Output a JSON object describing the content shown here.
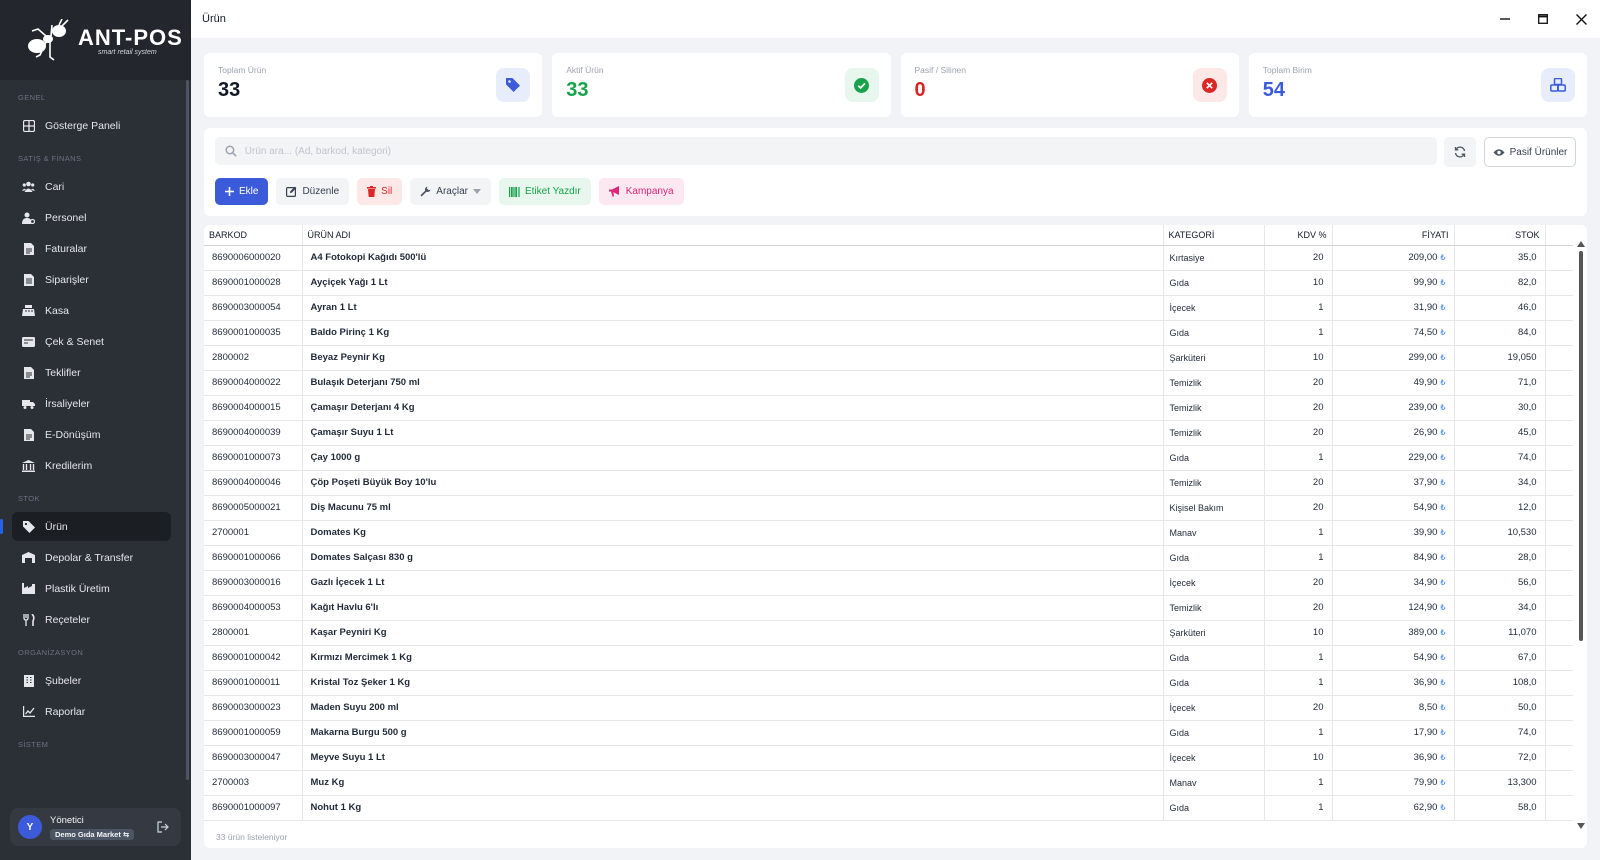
{
  "app": {
    "logo_title": "ANT-POS",
    "logo_subtitle": "smart retail system",
    "window_title": "Ürün"
  },
  "sidebar": {
    "sections": {
      "genel": "GENEL",
      "satis": "SATIŞ & FİNANS",
      "stok": "STOK",
      "org": "ORGANİZASYON",
      "sistem": "SİSTEM"
    },
    "items": [
      {
        "label": "Gösterge Paneli",
        "icon": "dashboard-icon"
      },
      {
        "label": "Cari",
        "icon": "users-icon"
      },
      {
        "label": "Personel",
        "icon": "user-cog-icon"
      },
      {
        "label": "Faturalar",
        "icon": "invoice-icon"
      },
      {
        "label": "Siparişler",
        "icon": "orders-icon"
      },
      {
        "label": "Kasa",
        "icon": "cash-register-icon"
      },
      {
        "label": "Çek & Senet",
        "icon": "check-icon"
      },
      {
        "label": "Teklifler",
        "icon": "offers-icon"
      },
      {
        "label": "İrsaliyeler",
        "icon": "truck-icon"
      },
      {
        "label": "E-Dönüşüm",
        "icon": "e-document-icon"
      },
      {
        "label": "Kredilerim",
        "icon": "bank-icon"
      },
      {
        "label": "Ürün",
        "icon": "tag-icon"
      },
      {
        "label": "Depolar & Transfer",
        "icon": "warehouse-icon"
      },
      {
        "label": "Plastik Üretim",
        "icon": "factory-icon"
      },
      {
        "label": "Reçeteler",
        "icon": "recipe-icon"
      },
      {
        "label": "Şubeler",
        "icon": "branch-icon"
      },
      {
        "label": "Raporlar",
        "icon": "chart-icon"
      }
    ],
    "user": {
      "initial": "Y",
      "name": "Yönetici",
      "store": "Demo Gıda Market ⇆"
    }
  },
  "stats": [
    {
      "label": "Toplam Ürün",
      "value": "33",
      "color": "#111827",
      "icon": "tag-icon",
      "icon_color": "#3b5bdb",
      "icon_bg": "#e8edfb"
    },
    {
      "label": "Aktif Ürün",
      "value": "33",
      "color": "#16a34a",
      "icon": "check-circle-icon",
      "icon_color": "#16a34a",
      "icon_bg": "#e7f7ee"
    },
    {
      "label": "Pasif / Silinen",
      "value": "0",
      "color": "#dc2626",
      "icon": "x-circle-icon",
      "icon_color": "#dc2626",
      "icon_bg": "#fde8e8"
    },
    {
      "label": "Toplam Birim",
      "value": "54",
      "color": "#3b5bdb",
      "icon": "cubes-icon",
      "icon_color": "#3b5bdb",
      "icon_bg": "#e8edfb"
    }
  ],
  "toolbar": {
    "search_placeholder": "Ürün ara... (Ad, barkod, kategori)",
    "passive_label": "Pasif Ürünler",
    "add_label": "Ekle",
    "edit_label": "Düzenle",
    "delete_label": "Sil",
    "tools_label": "Araçlar",
    "print_label": "Etiket Yazdır",
    "campaign_label": "Kampanya"
  },
  "table": {
    "headers": {
      "barcode": "BARKOD",
      "name": "ÜRÜN ADI",
      "category": "KATEGORİ",
      "vat": "KDV %",
      "price": "FİYATI",
      "stock": "STOK"
    },
    "currency": "₺",
    "rows": [
      {
        "barcode": "8690006000020",
        "name": "A4 Fotokopi Kağıdı 500'lü",
        "category": "Kırtasiye",
        "vat": "20",
        "price": "209,00",
        "stock": "35,0"
      },
      {
        "barcode": "8690001000028",
        "name": "Ayçiçek Yağı 1 Lt",
        "category": "Gıda",
        "vat": "10",
        "price": "99,90",
        "stock": "82,0"
      },
      {
        "barcode": "8690003000054",
        "name": "Ayran 1 Lt",
        "category": "İçecek",
        "vat": "1",
        "price": "31,90",
        "stock": "46,0"
      },
      {
        "barcode": "8690001000035",
        "name": "Baldo Pirinç 1 Kg",
        "category": "Gıda",
        "vat": "1",
        "price": "74,50",
        "stock": "84,0"
      },
      {
        "barcode": "2800002",
        "name": "Beyaz Peynir Kg",
        "category": "Şarküteri",
        "vat": "10",
        "price": "299,00",
        "stock": "19,050"
      },
      {
        "barcode": "8690004000022",
        "name": "Bulaşık Deterjanı 750 ml",
        "category": "Temizlik",
        "vat": "20",
        "price": "49,90",
        "stock": "71,0"
      },
      {
        "barcode": "8690004000015",
        "name": "Çamaşır Deterjanı 4 Kg",
        "category": "Temizlik",
        "vat": "20",
        "price": "239,00",
        "stock": "30,0"
      },
      {
        "barcode": "8690004000039",
        "name": "Çamaşır Suyu 1 Lt",
        "category": "Temizlik",
        "vat": "20",
        "price": "26,90",
        "stock": "45,0"
      },
      {
        "barcode": "8690001000073",
        "name": "Çay 1000 g",
        "category": "Gıda",
        "vat": "1",
        "price": "229,00",
        "stock": "74,0"
      },
      {
        "barcode": "8690004000046",
        "name": "Çöp Poşeti Büyük Boy 10'lu",
        "category": "Temizlik",
        "vat": "20",
        "price": "37,90",
        "stock": "34,0"
      },
      {
        "barcode": "8690005000021",
        "name": "Diş Macunu 75 ml",
        "category": "Kişisel Bakım",
        "vat": "20",
        "price": "54,90",
        "stock": "12,0"
      },
      {
        "barcode": "2700001",
        "name": "Domates Kg",
        "category": "Manav",
        "vat": "1",
        "price": "39,90",
        "stock": "10,530"
      },
      {
        "barcode": "8690001000066",
        "name": "Domates Salçası 830 g",
        "category": "Gıda",
        "vat": "1",
        "price": "84,90",
        "stock": "28,0"
      },
      {
        "barcode": "8690003000016",
        "name": "Gazlı İçecek 1 Lt",
        "category": "İçecek",
        "vat": "20",
        "price": "34,90",
        "stock": "56,0"
      },
      {
        "barcode": "8690004000053",
        "name": "Kağıt Havlu 6'lı",
        "category": "Temizlik",
        "vat": "20",
        "price": "124,90",
        "stock": "34,0"
      },
      {
        "barcode": "2800001",
        "name": "Kaşar Peyniri Kg",
        "category": "Şarküteri",
        "vat": "10",
        "price": "389,00",
        "stock": "11,070"
      },
      {
        "barcode": "8690001000042",
        "name": "Kırmızı Mercimek 1 Kg",
        "category": "Gıda",
        "vat": "1",
        "price": "54,90",
        "stock": "67,0"
      },
      {
        "barcode": "8690001000011",
        "name": "Kristal Toz Şeker 1 Kg",
        "category": "Gıda",
        "vat": "1",
        "price": "36,90",
        "stock": "108,0"
      },
      {
        "barcode": "8690003000023",
        "name": "Maden Suyu 200 ml",
        "category": "İçecek",
        "vat": "20",
        "price": "8,50",
        "stock": "50,0"
      },
      {
        "barcode": "8690001000059",
        "name": "Makarna Burgu 500 g",
        "category": "Gıda",
        "vat": "1",
        "price": "17,90",
        "stock": "74,0"
      },
      {
        "barcode": "8690003000047",
        "name": "Meyve Suyu 1 Lt",
        "category": "İçecek",
        "vat": "10",
        "price": "36,90",
        "stock": "72,0"
      },
      {
        "barcode": "2700003",
        "name": "Muz Kg",
        "category": "Manav",
        "vat": "1",
        "price": "79,90",
        "stock": "13,300"
      },
      {
        "barcode": "8690001000097",
        "name": "Nohut 1 Kg",
        "category": "Gıda",
        "vat": "1",
        "price": "62,90",
        "stock": "58,0"
      }
    ],
    "footer": "33 ürün listeleniyor"
  }
}
